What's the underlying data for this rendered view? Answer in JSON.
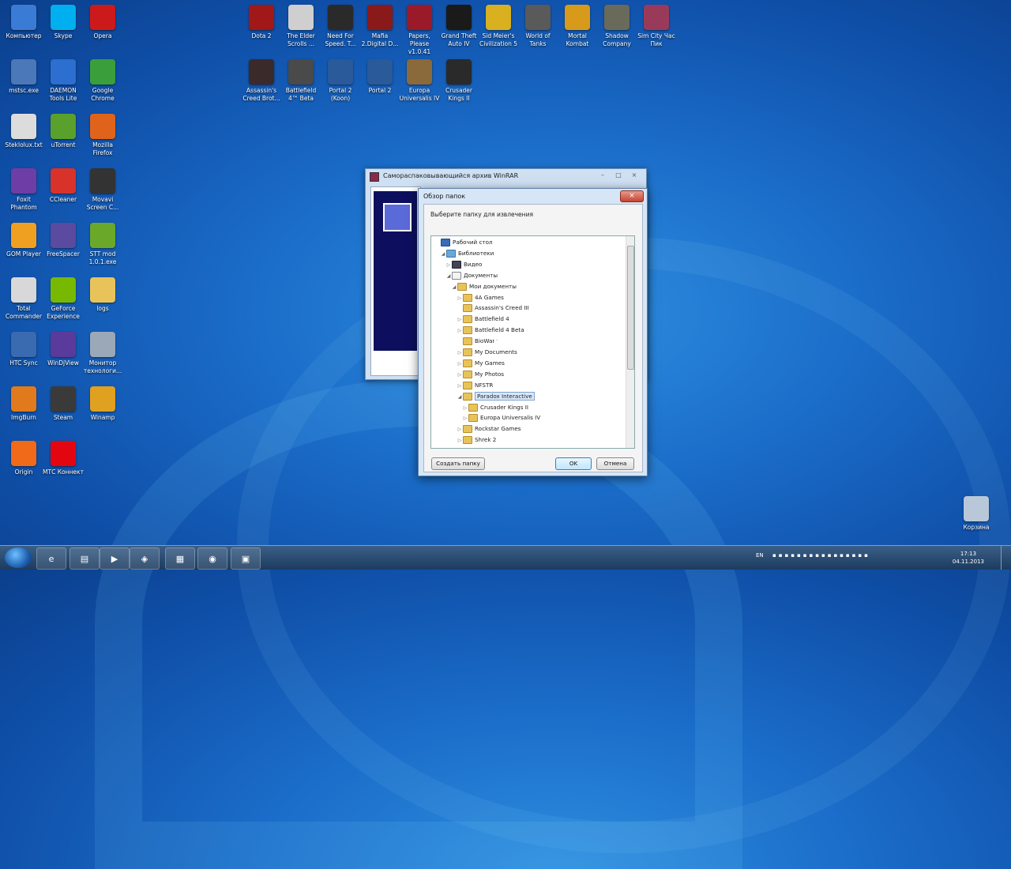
{
  "desktop": {
    "icons": [
      {
        "label": "Компьютер",
        "icon": "computer-icon",
        "color": "#3a7bd5"
      },
      {
        "label": "Skype",
        "icon": "skype-icon",
        "color": "#00aff0"
      },
      {
        "label": "Opera",
        "icon": "opera-icon",
        "color": "#cc1a1a"
      },
      {
        "label": "mstsc.exe",
        "icon": "remote-desktop-icon",
        "color": "#4a78b8"
      },
      {
        "label": "DAEMON Tools Lite",
        "icon": "daemon-tools-icon",
        "color": "#2d6fd0"
      },
      {
        "label": "Google Chrome",
        "icon": "chrome-icon",
        "color": "#3a9f3a"
      },
      {
        "label": "Stekloluх.txt",
        "icon": "text-file-icon",
        "color": "#dcdcdc"
      },
      {
        "label": "uTorrent",
        "icon": "utorrent-icon",
        "color": "#5aa02c"
      },
      {
        "label": "Mozilla Firefox",
        "icon": "firefox-icon",
        "color": "#e0631c"
      },
      {
        "label": "Foxit Phantom",
        "icon": "foxit-icon",
        "color": "#6e3da6"
      },
      {
        "label": "CCleaner",
        "icon": "ccleaner-icon",
        "color": "#d8322b"
      },
      {
        "label": "Movavi Screen C...",
        "icon": "movavi-icon",
        "color": "#333333"
      },
      {
        "label": "GOM Player",
        "icon": "gom-player-icon",
        "color": "#f0a020"
      },
      {
        "label": "FreeSpacer",
        "icon": "freespacer-icon",
        "color": "#5a4aa0"
      },
      {
        "label": "STT mod 1.0.1.exe",
        "icon": "installer-icon",
        "color": "#6aa82a"
      },
      {
        "label": "Total Commander",
        "icon": "total-commander-icon",
        "color": "#d8d8d8"
      },
      {
        "label": "GeForce Experience",
        "icon": "geforce-icon",
        "color": "#76b900"
      },
      {
        "label": "logs",
        "icon": "folder-icon",
        "color": "#e8c35a"
      },
      {
        "label": "HTC Sync",
        "icon": "htc-sync-icon",
        "color": "#3a6ab0"
      },
      {
        "label": "WinDjView",
        "icon": "windjview-icon",
        "color": "#5a3a9a"
      },
      {
        "label": "Монитор технологи...",
        "icon": "monitor-icon",
        "color": "#9aa8b8"
      },
      {
        "label": "ImgBurn",
        "icon": "imgburn-icon",
        "color": "#e07a1c"
      },
      {
        "label": "Steam",
        "icon": "steam-icon",
        "color": "#3a3a3a"
      },
      {
        "label": "Winamp",
        "icon": "winamp-icon",
        "color": "#e0a020"
      },
      {
        "label": "Origin",
        "icon": "origin-icon",
        "color": "#f06a1a"
      },
      {
        "label": "МТС Коннект",
        "icon": "mts-icon",
        "color": "#e30611"
      },
      {
        "label": "Dota 2",
        "icon": "dota2-icon",
        "color": "#a01818"
      },
      {
        "label": "The Elder Scrolls ...",
        "icon": "skyrim-icon",
        "color": "#cfcfcf"
      },
      {
        "label": "Need For Speed. T...",
        "icon": "nfs-icon",
        "color": "#2a2a2a"
      },
      {
        "label": "Mafia 2.Digital D...",
        "icon": "mafia-icon",
        "color": "#8a1a1a"
      },
      {
        "label": "Papers, Please v1.0.41",
        "icon": "papers-please-icon",
        "color": "#9a1a2a"
      },
      {
        "label": "Grand Theft Auto IV",
        "icon": "gta4-icon",
        "color": "#1a1a1a"
      },
      {
        "label": "Sid Meier's Civilization 5",
        "icon": "civ5-icon",
        "color": "#d8b020"
      },
      {
        "label": "World of Tanks",
        "icon": "wot-icon",
        "color": "#5a5a5a"
      },
      {
        "label": "Mortal Kombat",
        "icon": "mk-icon",
        "color": "#d89a1a"
      },
      {
        "label": "Shadow Company",
        "icon": "shadow-company-icon",
        "color": "#6a6a5a"
      },
      {
        "label": "Sim City Час Пик",
        "icon": "simcity-icon",
        "color": "#9a3a5a"
      },
      {
        "label": "Assassin's Creed Brot...",
        "icon": "ac-brotherhood-icon",
        "color": "#3a2a2a"
      },
      {
        "label": "Battlefield 4™ Beta",
        "icon": "bf4-icon",
        "color": "#4a4a4a"
      },
      {
        "label": "Portal 2 (Koon)",
        "icon": "portal2-icon",
        "color": "#2a5a9a"
      },
      {
        "label": "Portal 2",
        "icon": "portal2-icon",
        "color": "#2a5a9a"
      },
      {
        "label": "Europa Universalis IV",
        "icon": "eu4-icon",
        "color": "#8a6a3a"
      },
      {
        "label": "Crusader Kings II",
        "icon": "ck2-icon",
        "color": "#2a2a2a"
      },
      {
        "label": "Корзина",
        "icon": "recycle-bin-icon",
        "color": "#b8c8d8"
      }
    ]
  },
  "winrar": {
    "title": "Самораспаковывающийся архив WinRAR",
    "minimize": "–",
    "maximize": "□",
    "close": "×"
  },
  "dialog": {
    "title": "Обзор папок",
    "close": "×",
    "prompt": "Выберите папку для извлечения",
    "tree": [
      {
        "label": "Рабочий стол",
        "arrow": "",
        "kind": "desktop",
        "indent": 0
      },
      {
        "label": "Библиотеки",
        "arrow": "◢",
        "kind": "library",
        "indent": 1
      },
      {
        "label": "Видео",
        "arrow": "▷",
        "kind": "video",
        "indent": 2
      },
      {
        "label": "Документы",
        "arrow": "◢",
        "kind": "docs",
        "indent": 2
      },
      {
        "label": "Мои документы",
        "arrow": "◢",
        "kind": "folder",
        "indent": 3
      },
      {
        "label": "4A Games",
        "arrow": "▷",
        "kind": "folder",
        "indent": 4
      },
      {
        "label": "Assassin's Creed III",
        "arrow": "",
        "kind": "folder",
        "indent": 4
      },
      {
        "label": "Battlefield 4",
        "arrow": "▷",
        "kind": "folder",
        "indent": 4
      },
      {
        "label": "Battlefield 4 Beta",
        "arrow": "▷",
        "kind": "folder",
        "indent": 4
      },
      {
        "label": "BioWare",
        "arrow": "",
        "kind": "folder",
        "indent": 4
      },
      {
        "label": "My Documents",
        "arrow": "▷",
        "kind": "folder",
        "indent": 4
      },
      {
        "label": "My Games",
        "arrow": "▷",
        "kind": "folder",
        "indent": 4
      },
      {
        "label": "My Photos",
        "arrow": "▷",
        "kind": "folder",
        "indent": 4
      },
      {
        "label": "NFSTR",
        "arrow": "▷",
        "kind": "folder",
        "indent": 4
      },
      {
        "label": "Paradox Interactive",
        "arrow": "◢",
        "kind": "folder",
        "indent": 4,
        "selected": true
      },
      {
        "label": "Crusader Kings II",
        "arrow": "▷",
        "kind": "folder",
        "indent": 5
      },
      {
        "label": "Europa Universalis IV",
        "arrow": "▷",
        "kind": "folder",
        "indent": 5
      },
      {
        "label": "Rockstar Games",
        "arrow": "▷",
        "kind": "folder",
        "indent": 4
      },
      {
        "label": "Shrek 2",
        "arrow": "▷",
        "kind": "folder",
        "indent": 4
      }
    ],
    "new_folder": "Создать папку",
    "ok": "OK",
    "cancel": "Отмена"
  },
  "taskbar": {
    "items": [
      {
        "icon": "ie-icon",
        "glyph": "e"
      },
      {
        "icon": "explorer-icon",
        "glyph": "▤"
      },
      {
        "icon": "media-player-icon",
        "glyph": "▶"
      },
      {
        "icon": "hdd-tool-icon",
        "glyph": "◈"
      },
      {
        "icon": "apps-grid-icon",
        "glyph": "▦"
      },
      {
        "icon": "chrome-icon",
        "glyph": "◉"
      },
      {
        "icon": "winrar-icon",
        "glyph": "▣"
      }
    ],
    "lang": "EN",
    "time": "17:13",
    "date": "04.11.2013"
  }
}
